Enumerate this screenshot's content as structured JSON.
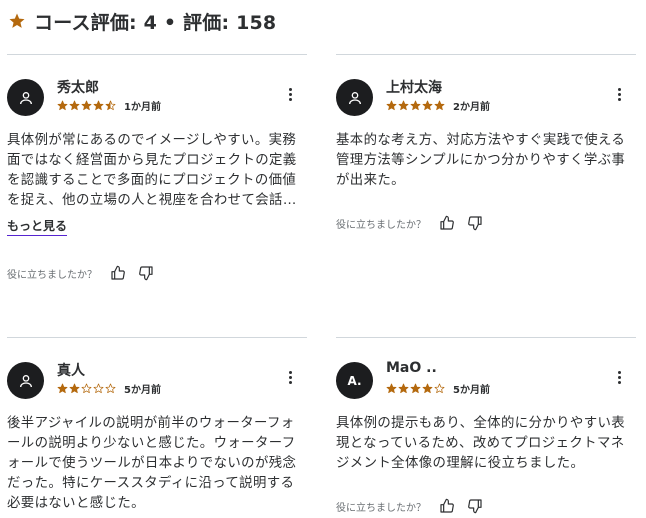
{
  "header": {
    "title": "コース評価: 4 • 評価: 158",
    "star_color": "#b4690e"
  },
  "helpful_label": "役に立ちましたか？",
  "more_label": "もっと見る",
  "reviews": [
    {
      "avatar_letter": "",
      "name": "秀太郎",
      "rating": 4.5,
      "date": "1か月前",
      "text": "具体例が常にあるのでイメージしやすい。実務面ではなく経営面から見たプロジェクトの定義を認識することで多面的にプロジェクトの価値を捉え、他の立場の人と視座を合わせて会話ができそう。翻訳コンテンツ自体の…"
    },
    {
      "avatar_letter": "",
      "name": "上村太海",
      "rating": 5,
      "date": "2か月前",
      "text": "基本的な考え方、対応方法やすぐ実践で使える管理方法等シンプルにかつ分かりやすく学ぶ事が出来た。"
    },
    {
      "avatar_letter": "",
      "name": "真人",
      "rating": 2,
      "date": "5か月前",
      "text": "後半アジャイルの説明が前半のウォーターフォールの説明より少ないと感じた。ウォーターフォールで使うツールが日本よりでないのが残念だった。特にケーススタディに沿って説明する必要はないと感じた。"
    },
    {
      "avatar_letter": "A.",
      "name": "MaO ..",
      "rating": 4,
      "date": "5か月前",
      "text": "具体例の提示もあり、全体的に分かりやすい表現となっているため、改めてプロジェクトマネジメント全体像の理解に役立ちました。"
    }
  ]
}
